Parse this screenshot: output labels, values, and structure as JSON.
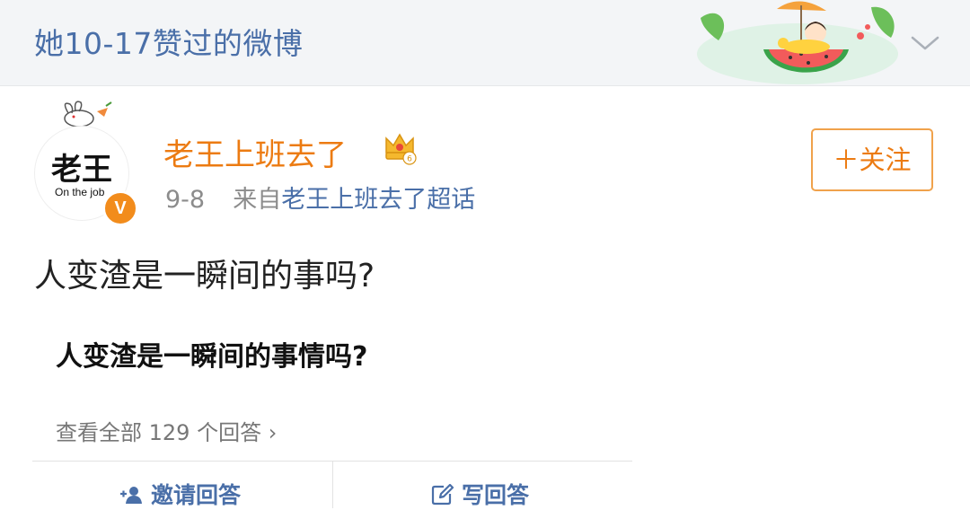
{
  "header": {
    "title": "她10-17赞过的微博"
  },
  "post": {
    "avatar": {
      "text": "老王",
      "subtitle": "On the job",
      "verified_badge": "V"
    },
    "author": "老王上班去了",
    "date": "9-8",
    "source_prefix": "来自",
    "source_link": "老王上班去了超话",
    "follow_label": "＋关注",
    "question": "人变渣是一瞬间的事吗?",
    "embedded": {
      "title": "人变渣是一瞬间的事情吗?",
      "view_all": "查看全部 129 个回答 ›"
    },
    "actions": {
      "invite": "邀请回答",
      "write": "写回答"
    }
  },
  "colors": {
    "accent_orange": "#ec7b12",
    "link_blue": "#4a6fa8",
    "header_bg": "#f3f5f7"
  },
  "icons": [
    "watermelon-banner-icon",
    "chevron-down-icon",
    "crown-icon",
    "add-user-icon",
    "edit-icon"
  ]
}
